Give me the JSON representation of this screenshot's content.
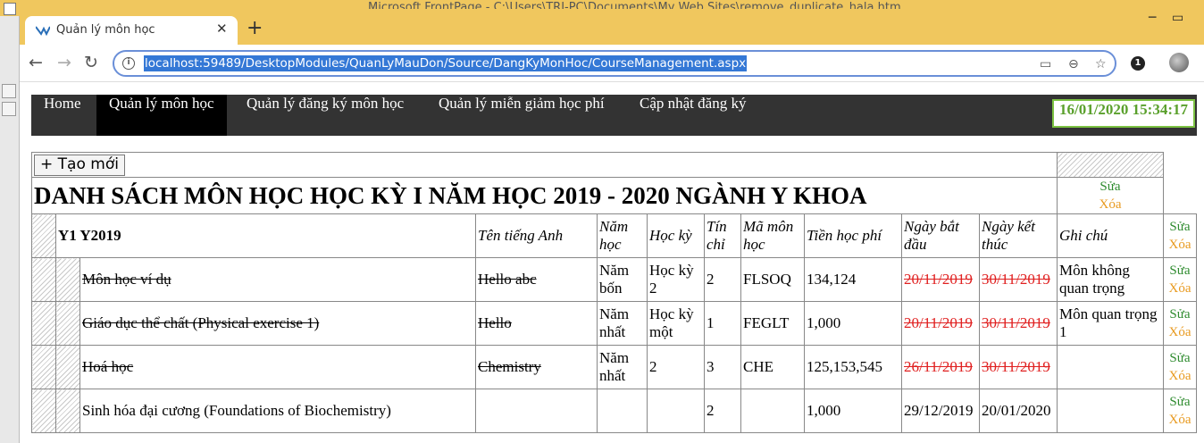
{
  "host": {
    "title": "Microsoft FrontPage - C:\\Users\\TRI-PC\\Documents\\My Web Sites\\remove_duplicate_hala.htm"
  },
  "browser": {
    "tab_title": "Quản lý môn học",
    "tab_close": "✕",
    "new_tab": "+",
    "url": "localhost:59489/DesktopModules/QuanLyMauDon/Source/DangKyMonHoc/CourseManagement.aspx",
    "ext_badge": "1"
  },
  "nav": {
    "items": [
      {
        "label": "Home"
      },
      {
        "label": "Quản lý môn học"
      },
      {
        "label": "Quản lý đăng ký môn học"
      },
      {
        "label": "Quản lý miễn giảm học phí"
      },
      {
        "label": "Cập nhật đăng ký"
      }
    ],
    "clock": "16/01/2020 15:34:17"
  },
  "table": {
    "new_button": "+ Tạo mới",
    "title": "DANH SÁCH MÔN HỌC HỌC KỲ I NĂM HỌC 2019 - 2020 NGÀNH Y KHOA",
    "edit_label": "Sửa",
    "delete_label": "Xóa",
    "group": "Y1 Y2019",
    "headers": {
      "english": "Tên tiếng Anh",
      "year": "Năm học",
      "semester": "Học kỳ",
      "credits": "Tín chỉ",
      "code": "Mã môn học",
      "fee": "Tiền học phí",
      "start": "Ngày bắt đầu",
      "end": "Ngày kết thúc",
      "note": "Ghi chú"
    },
    "rows": [
      {
        "name": "Môn học ví dụ",
        "english": "Hello abc",
        "year": "Năm bốn",
        "semester": "Học kỳ 2",
        "credits": "2",
        "code": "FLSOQ",
        "fee": "134,124",
        "start": "20/11/2019",
        "end": "30/11/2019",
        "note": "Môn không quan trọng"
      },
      {
        "name": "Giáo dục thể chất (Physical exercise 1)",
        "english": "Hello",
        "year": "Năm nhất",
        "semester": "Học kỳ một",
        "credits": "1",
        "code": "FEGLT",
        "fee": "1,000",
        "start": "20/11/2019",
        "end": "30/11/2019",
        "note": "Môn quan trọng 1"
      },
      {
        "name": "Hoá học",
        "english": "Chemistry",
        "year": "Năm nhất",
        "semester": "2",
        "credits": "3",
        "code": "CHE",
        "fee": "125,153,545",
        "start": "26/11/2019",
        "end": "30/11/2019",
        "note": ""
      },
      {
        "name": "Sinh hóa đại cương (Foundations of Biochemistry)",
        "english": "",
        "year": "",
        "semester": "",
        "credits": "2",
        "code": "",
        "fee": "1,000",
        "start": "29/12/2019",
        "end": "20/01/2020",
        "note": ""
      }
    ]
  }
}
